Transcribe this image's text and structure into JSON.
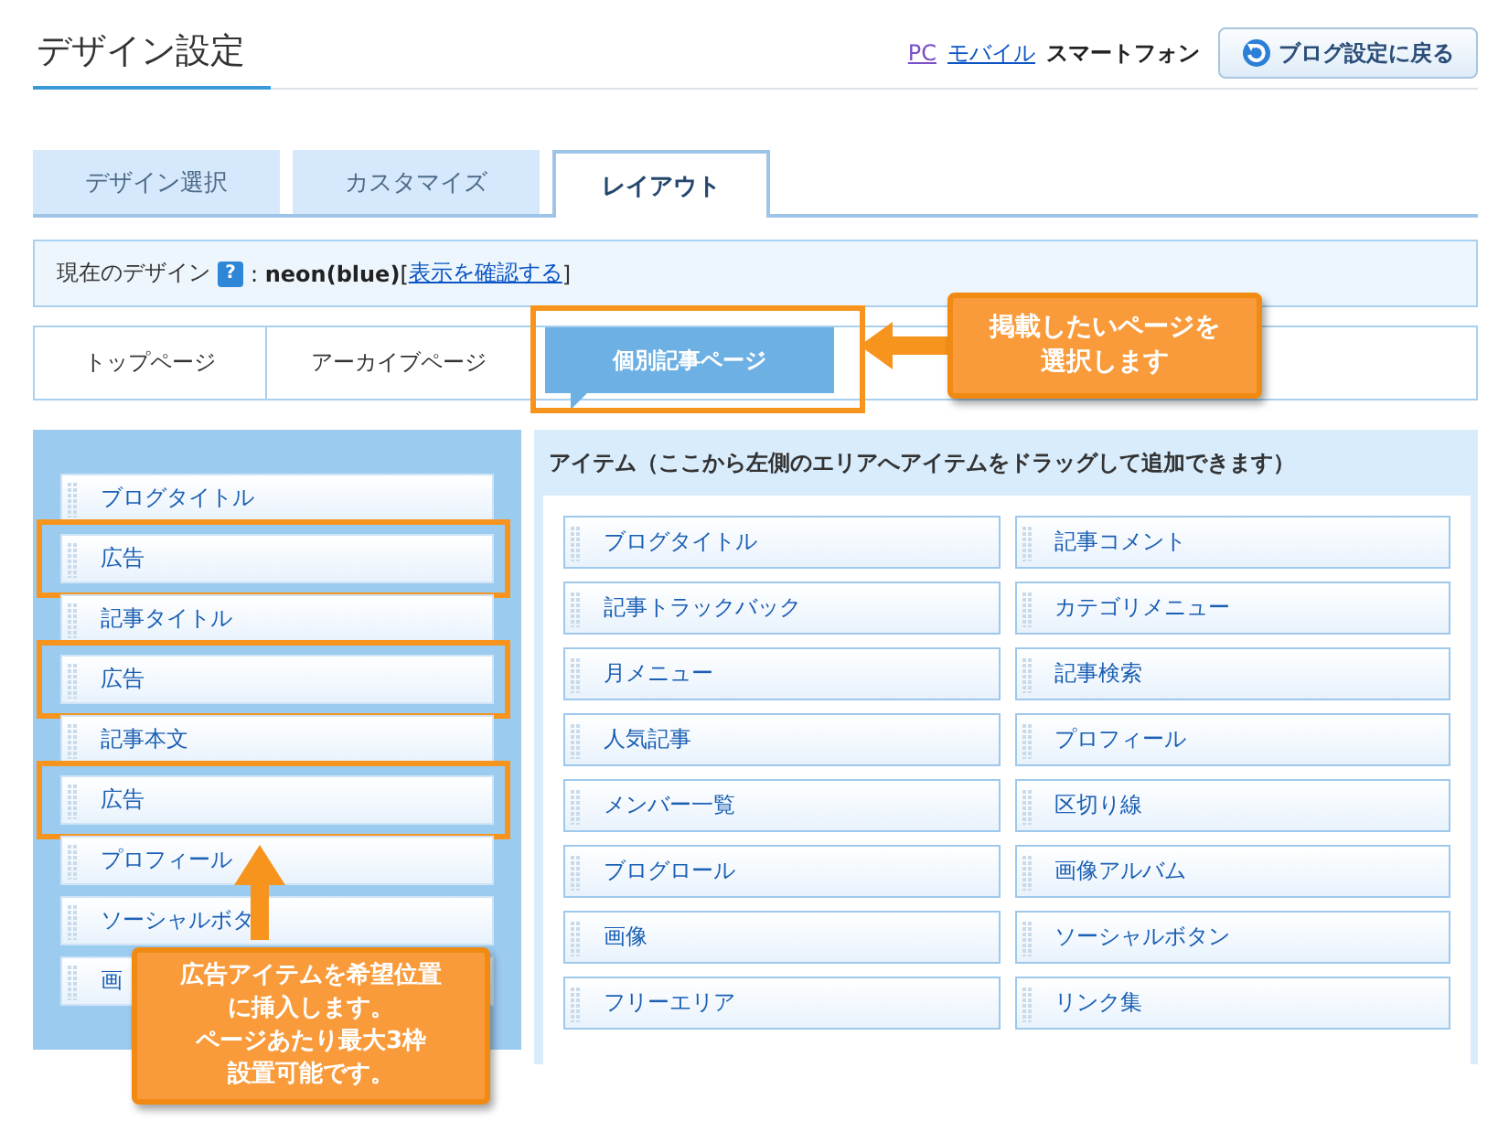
{
  "header": {
    "title": "デザイン設定",
    "device_links": [
      {
        "label": "PC",
        "selected": false,
        "visited": true
      },
      {
        "label": "モバイル",
        "selected": false,
        "visited": false
      },
      {
        "label": "スマートフォン",
        "selected": true,
        "visited": false
      }
    ],
    "back_button": "ブログ設定に戻る"
  },
  "tabs": [
    {
      "label": "デザイン選択",
      "selected": false
    },
    {
      "label": "カスタマイズ",
      "selected": false
    },
    {
      "label": "レイアウト",
      "selected": true
    }
  ],
  "current_design": {
    "label": "現在のデザイン",
    "help": "?",
    "value": ": **neon(blue)**[",
    "link": "表示を確認する",
    "close": "]"
  },
  "page_tabs": [
    {
      "label": "トップページ",
      "selected": false,
      "highlighted": false
    },
    {
      "label": "アーカイブページ",
      "selected": false,
      "highlighted": false
    },
    {
      "label": "個別記事ページ",
      "selected": true,
      "highlighted": true
    }
  ],
  "layout_items": [
    {
      "label": "ブログタイトル",
      "highlighted": false
    },
    {
      "label": "広告",
      "highlighted": true
    },
    {
      "label": "記事タイトル",
      "highlighted": false
    },
    {
      "label": "広告",
      "highlighted": true
    },
    {
      "label": "記事本文",
      "highlighted": false
    },
    {
      "label": "広告",
      "highlighted": true
    },
    {
      "label": "プロフィール",
      "highlighted": false
    },
    {
      "label": "ソーシャルボタ",
      "highlighted": false
    },
    {
      "label": "画",
      "highlighted": false
    }
  ],
  "items_panel": {
    "title": "アイテム（ここから左側のエリアへアイテムをドラッグして追加できます）",
    "items": [
      "ブログタイトル",
      "記事コメント",
      "記事トラックバック",
      "カテゴリメニュー",
      "月メニュー",
      "記事検索",
      "人気記事",
      "プロフィール",
      "メンバー一覧",
      "区切り線",
      "ブログロール",
      "画像アルバム",
      "画像",
      "ソーシャルボタン",
      "フリーエリア",
      "リンク集"
    ]
  },
  "callouts": [
    {
      "lines": [
        "掲載したいページを",
        "選択します"
      ]
    },
    {
      "lines": [
        "広告アイテムを希望位置",
        "に挿入します。",
        "ページあたり最大3枠",
        "設置可能です。"
      ]
    }
  ]
}
